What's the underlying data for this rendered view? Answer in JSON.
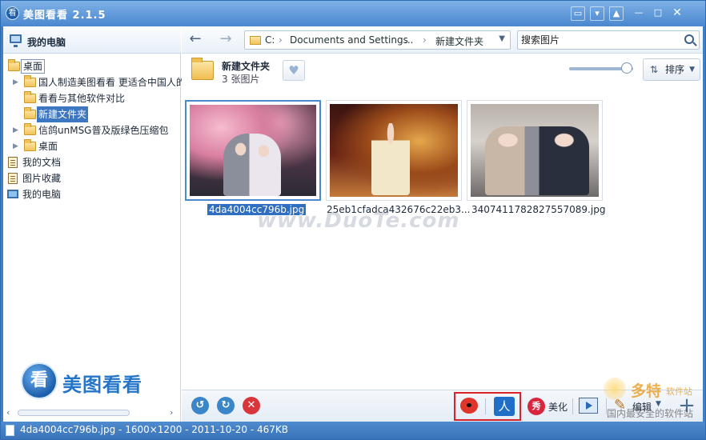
{
  "window": {
    "title": "美图看看 2.1.5",
    "app_icon_glyph": "看",
    "buttons": [
      "comment-icon",
      "menu-icon",
      "skin-icon",
      "minimize-icon",
      "maximize-icon",
      "close-icon"
    ]
  },
  "sidebar": {
    "header": "我的电脑",
    "tree": [
      {
        "label": "桌面",
        "level": 0,
        "expanded": true,
        "icon": "folder-icon"
      },
      {
        "label": "国人制造美图看看 更适合中国人的",
        "level": 1,
        "arrow": "▶",
        "icon": "folder-icon"
      },
      {
        "label": "看看与其他软件对比",
        "level": 1,
        "icon": "folder-icon"
      },
      {
        "label": "新建文件夹",
        "level": 1,
        "selected": true,
        "icon": "folder-icon"
      },
      {
        "label": "信鸽unMSG普及版绿色压缩包",
        "level": 1,
        "arrow": "▶",
        "icon": "folder-icon"
      },
      {
        "label": "桌面",
        "level": 1,
        "arrow": "▶",
        "icon": "folder-icon"
      },
      {
        "label": "我的文档",
        "level": 0,
        "icon": "document-icon"
      },
      {
        "label": "图片收藏",
        "level": 0,
        "icon": "document-icon"
      },
      {
        "label": "我的电脑",
        "level": 0,
        "icon": "computer-icon"
      }
    ],
    "logo_glyph": "看",
    "logo_text": "美图看看"
  },
  "nav": {
    "back": "←",
    "forward": "→",
    "path_drive": "C:",
    "path_sep": "›",
    "path_segments": [
      "Documents and Settings",
      "...",
      "新建文件夹"
    ],
    "search_placeholder": "搜索图片"
  },
  "folder": {
    "title": "新建文件夹",
    "count": "3 张图片",
    "zoom_level": 0.9,
    "sort_label": "排序"
  },
  "thumbnails": [
    {
      "caption": "4da4004cc796b.jpg",
      "selected": true
    },
    {
      "caption": "25eb1cfadca432676c22eb3...",
      "selected": false
    },
    {
      "caption": "3407411782827557089.jpg",
      "selected": false
    }
  ],
  "watermark": "www.DuoTe.com",
  "toolbar": {
    "rotate_left": "↺",
    "rotate_right": "↻",
    "delete": "✕",
    "beautify_glyph": "秀",
    "beautify_label": "美化",
    "edit_label": "编辑",
    "add": "+",
    "share_renren_glyph": "人"
  },
  "site_badge": {
    "name": "多特",
    "suffix": "软件站",
    "tagline": "国内最安全的软件站"
  },
  "status": {
    "text": "4da4004cc796b.jpg - 1600×1200 - 2011-10-20 - 467KB"
  }
}
